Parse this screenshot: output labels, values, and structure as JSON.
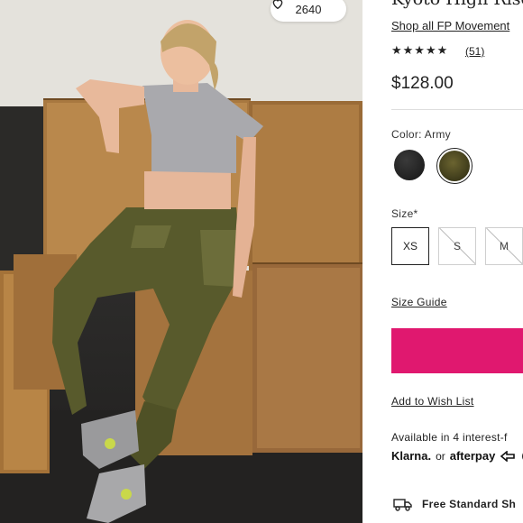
{
  "product": {
    "title": "Kyoto High Rise",
    "shop_link": "Shop all FP Movement",
    "rating_stars": "★★★★★",
    "review_count": "(51)",
    "price": "$128.00",
    "color_label": "Color: Army",
    "colors": [
      {
        "name": "black",
        "hex": "#1c1c1c"
      },
      {
        "name": "army",
        "hex": "#4f4a22"
      }
    ],
    "size_label": "Size*",
    "sizes": [
      {
        "label": "XS",
        "selected": true,
        "available": true
      },
      {
        "label": "S",
        "selected": false,
        "available": false
      },
      {
        "label": "M",
        "selected": false,
        "available": false
      }
    ],
    "size_guide": "Size Guide",
    "wishlist": "Add to Wish List",
    "installments": "Available in 4 interest-f",
    "klarna": "Klarna.",
    "or": "or",
    "afterpay": "afterpay",
    "info_glyph": "i",
    "shipping": "Free Standard Sh"
  },
  "photo": {
    "like_count": "2640"
  },
  "colors": {
    "add_to_bag": "#e0186f",
    "text": "#222222"
  }
}
